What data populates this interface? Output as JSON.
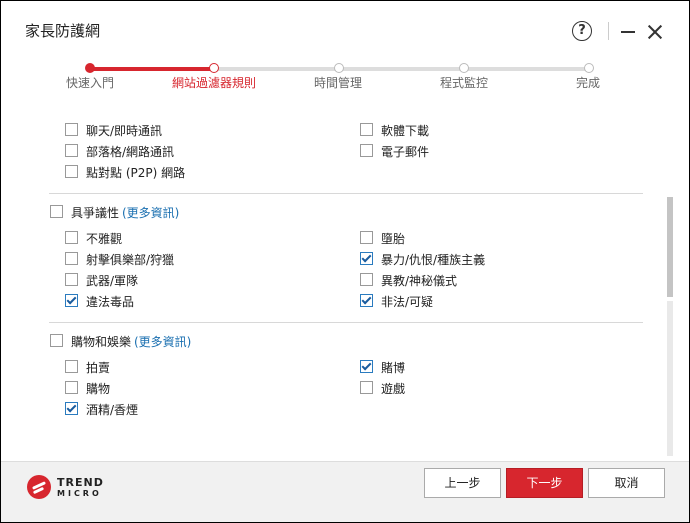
{
  "window": {
    "title": "家長防護網",
    "help_glyph": "?"
  },
  "stepper": {
    "steps": [
      {
        "label": "快速入門",
        "state": "done"
      },
      {
        "label": "網站過濾器規則",
        "state": "current"
      },
      {
        "label": "時間管理",
        "state": "todo"
      },
      {
        "label": "程式監控",
        "state": "todo"
      },
      {
        "label": "完成",
        "state": "todo"
      }
    ]
  },
  "group0": {
    "items": [
      {
        "label": "聊天/即時通訊",
        "checked": false
      },
      {
        "label": "軟體下載",
        "checked": false
      },
      {
        "label": "部落格/網路通訊",
        "checked": false
      },
      {
        "label": "電子郵件",
        "checked": false
      },
      {
        "label": "點對點 (P2P) 網路",
        "checked": false
      }
    ]
  },
  "group1": {
    "title": "具爭議性",
    "more": "(更多資訊)",
    "checked": false,
    "items": [
      {
        "label": "不雅觀",
        "checked": false
      },
      {
        "label": "墮胎",
        "checked": false
      },
      {
        "label": "射擊俱樂部/狩獵",
        "checked": false
      },
      {
        "label": "暴力/仇恨/種族主義",
        "checked": true
      },
      {
        "label": "武器/軍隊",
        "checked": false
      },
      {
        "label": "異教/神秘儀式",
        "checked": false
      },
      {
        "label": "違法毒品",
        "checked": true
      },
      {
        "label": "非法/可疑",
        "checked": true
      }
    ]
  },
  "group2": {
    "title": "購物和娛樂",
    "more": "(更多資訊)",
    "checked": false,
    "items": [
      {
        "label": "拍賣",
        "checked": false
      },
      {
        "label": "賭博",
        "checked": true
      },
      {
        "label": "購物",
        "checked": false
      },
      {
        "label": "遊戲",
        "checked": false
      },
      {
        "label": "酒精/香煙",
        "checked": true
      }
    ]
  },
  "footer": {
    "logo_line1": "TREND",
    "logo_line2": "MICRO",
    "back_label": "上一步",
    "next_label": "下一步",
    "cancel_label": "取消"
  },
  "colors": {
    "accent": "#d7262e",
    "link": "#1a6fb0",
    "check": "#1a5c9e"
  }
}
